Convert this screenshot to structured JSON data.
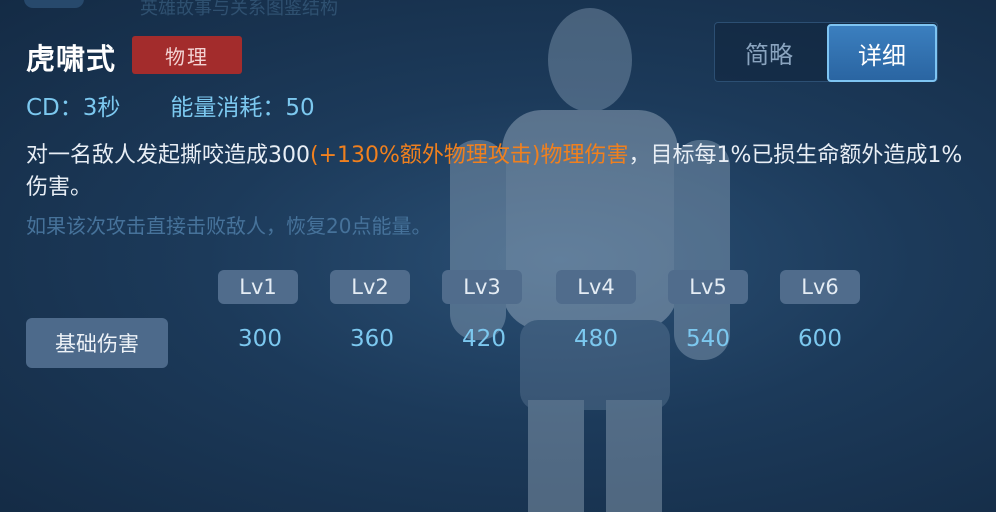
{
  "header_faint": "英雄故事与关系图鉴结构",
  "skill": {
    "name": "虎啸式",
    "type_badge": "物理",
    "cd": "CD：3秒",
    "energy": "能量消耗：50",
    "desc_part1": "对一名敌人发起撕咬造成300",
    "desc_highlight": "(+130%额外物理攻击)物理伤害",
    "desc_part2": "，目标每1%已损生命额外造成1%伤害。",
    "desc_extra": "如果该次攻击直接击败敌人，恢复20点能量。"
  },
  "toggle": {
    "brief": "简略",
    "detail": "详细",
    "selected": "详细"
  },
  "table": {
    "levels": [
      "Lv1",
      "Lv2",
      "Lv3",
      "Lv4",
      "Lv5",
      "Lv6"
    ],
    "row_label": "基础伤害",
    "values": [
      "300",
      "360",
      "420",
      "480",
      "540",
      "600"
    ]
  },
  "colors": {
    "highlight": "#f0801e",
    "stat_blue": "#7cc8ef",
    "badge_red": "#a32c2c",
    "accent_blue": "#2a65a2"
  }
}
